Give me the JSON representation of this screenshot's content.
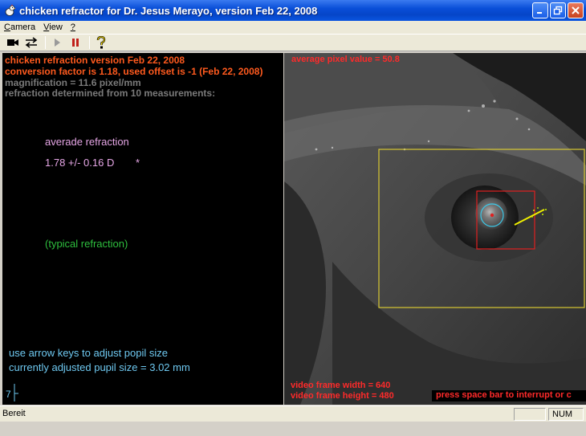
{
  "window": {
    "title": "chicken refractor for Dr. Jesus Merayo, version Feb 22, 2008",
    "icons": {
      "app": "chicken-app-icon",
      "minimize": "minimize-icon",
      "maximize": "maximize-icon",
      "close": "close-icon"
    }
  },
  "menu": {
    "items": [
      {
        "label": "Camera",
        "mnemonic": "C"
      },
      {
        "label": "View",
        "mnemonic": "V"
      },
      {
        "label": "?",
        "mnemonic": "?"
      }
    ]
  },
  "toolbar": {
    "buttons": [
      {
        "icon": "camera-icon"
      },
      {
        "icon": "adjust-icon"
      },
      {
        "icon": "play-icon"
      },
      {
        "icon": "pause-icon"
      },
      {
        "icon": "help-icon"
      }
    ]
  },
  "info": {
    "version_line": "chicken refraction version Feb 22, 2008",
    "conversion_line": "conversion factor is 1.18, used offset is -1 (Feb 22, 2008)",
    "magnification_line": "magnification = 11.6 pixel/mm",
    "measurements_line": "refraction determined from 10 measurements:",
    "average_label": "averade refraction",
    "average_value": "1.78 +/- 0.16 D",
    "average_marker": "*",
    "typical_label": "(typical refraction)",
    "hint_line": "use arrow keys to adjust popil size",
    "pupil_line": "currently adjusted pupil size = 3.02 mm",
    "axis_tick": "7"
  },
  "camera": {
    "pixel_value_line": "average pixel value = 50.8",
    "frame_width_line": "video frame width = 640",
    "frame_height_line": "video frame height = 480",
    "banner_line": "press space bar to interrupt or c",
    "colors": {
      "roi": "#d8c832",
      "pupil_box": "#e02020",
      "pupil_circle": "#3cc8e8",
      "line": "#f0f000"
    }
  },
  "status": {
    "text": "Bereit",
    "num_indicator": "NUM"
  }
}
